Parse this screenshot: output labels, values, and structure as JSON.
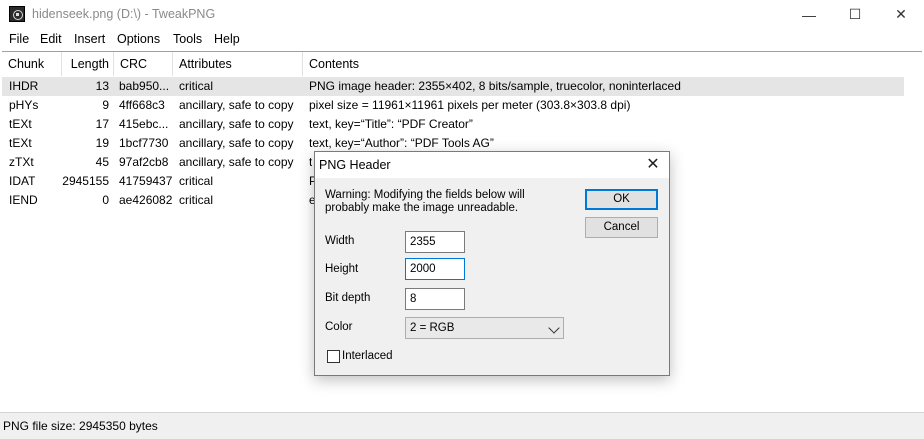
{
  "window": {
    "title": "hidenseek.png (D:\\) - TweakPNG",
    "minimize_glyph": "—",
    "maximize_glyph": "☐",
    "close_glyph": "✕"
  },
  "menu": [
    "File",
    "Edit",
    "Insert",
    "Options",
    "Tools",
    "Help"
  ],
  "list": {
    "columns": [
      "Chunk",
      "Length",
      "CRC",
      "Attributes",
      "Contents"
    ],
    "rows": [
      {
        "chunk": "IHDR",
        "length": "13",
        "crc": "bab950...",
        "attributes": "critical",
        "contents": "PNG image header: 2355×402, 8 bits/sample, truecolor, noninterlaced"
      },
      {
        "chunk": "pHYs",
        "length": "9",
        "crc": "4ff668c3",
        "attributes": "ancillary, safe to copy",
        "contents": "pixel size = 11961×11961 pixels per meter (303.8×303.8 dpi)"
      },
      {
        "chunk": "tEXt",
        "length": "17",
        "crc": "415ebc...",
        "attributes": "ancillary, safe to copy",
        "contents": "text, key=“Title”: “PDF Creator”"
      },
      {
        "chunk": "tEXt",
        "length": "19",
        "crc": "1bcf7730",
        "attributes": "ancillary, safe to copy",
        "contents": "text, key=“Author”: “PDF Tools AG”"
      },
      {
        "chunk": "zTXt",
        "length": "45",
        "crc": "97af2cb8",
        "attributes": "ancillary, safe to copy",
        "contents": "t"
      },
      {
        "chunk": "IDAT",
        "length": "2945155",
        "crc": "41759437",
        "attributes": "critical",
        "contents": "P"
      },
      {
        "chunk": "IEND",
        "length": "0",
        "crc": "ae426082",
        "attributes": "critical",
        "contents": "e"
      }
    ]
  },
  "status": "PNG file size: 2945350 bytes",
  "dialog": {
    "title": "PNG Header",
    "close_glyph": "✕",
    "warning": "Warning: Modifying the fields below will probably make the image unreadable.",
    "width_label": "Width",
    "width_value": "2355",
    "height_label": "Height",
    "height_value": "2000",
    "bitdepth_label": "Bit depth",
    "bitdepth_value": "8",
    "color_label": "Color",
    "color_value": "2 = RGB",
    "interlaced_label": "Interlaced",
    "interlaced_checked": false,
    "ok_label": "OK",
    "cancel_label": "Cancel"
  },
  "colors": {
    "selection": "#e5e5e5",
    "dialog_bg": "#f0f0f0",
    "accent": "#0078d7"
  }
}
